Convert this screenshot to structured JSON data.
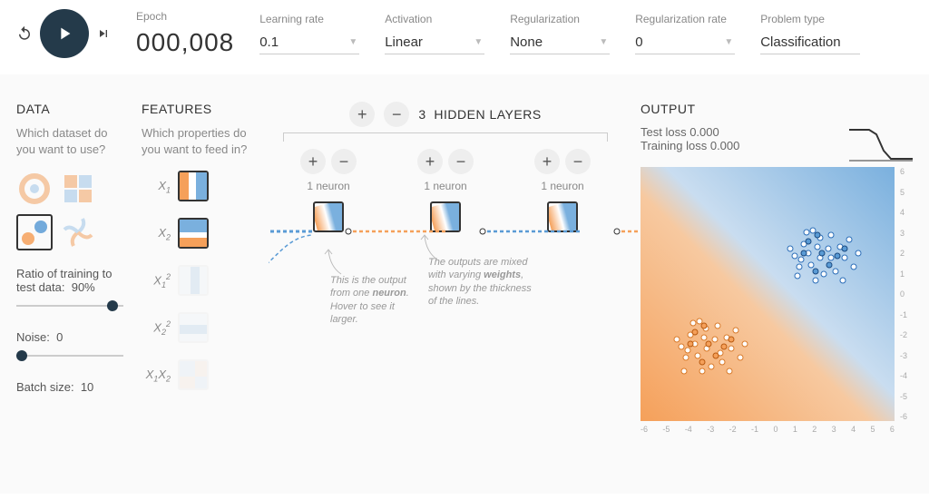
{
  "topbar": {
    "epoch_label": "Epoch",
    "epoch_value": "000,008",
    "learning_rate": {
      "label": "Learning rate",
      "value": "0.1"
    },
    "activation": {
      "label": "Activation",
      "value": "Linear"
    },
    "regularization": {
      "label": "Regularization",
      "value": "None"
    },
    "regularization_rate": {
      "label": "Regularization rate",
      "value": "0"
    },
    "problem_type": {
      "label": "Problem type",
      "value": "Classification"
    }
  },
  "data": {
    "title": "DATA",
    "desc": "Which dataset do you want to use?",
    "datasets": [
      "circle",
      "xor",
      "gauss",
      "spiral"
    ],
    "selected_dataset_index": 2,
    "ratio_label": "Ratio of training to test data:",
    "ratio_value": "90%",
    "noise_label": "Noise:",
    "noise_value": "0",
    "batch_label": "Batch size:",
    "batch_value": "10"
  },
  "features": {
    "title": "FEATURES",
    "desc": "Which properties do you want to feed in?",
    "items": [
      {
        "label_html": "X<sub>1</sub>",
        "active": true
      },
      {
        "label_html": "X<sub>2</sub>",
        "active": true
      },
      {
        "label_html": "X<sub>1</sub><sup>2</sup>",
        "active": false
      },
      {
        "label_html": "X<sub>2</sub><sup>2</sup>",
        "active": false
      },
      {
        "label_html": "X<sub>1</sub>X<sub>2</sub>",
        "active": false
      }
    ]
  },
  "network": {
    "layers_count": "3",
    "hidden_title": "HIDDEN LAYERS",
    "layers": [
      {
        "neurons": "1 neuron"
      },
      {
        "neurons": "1 neuron"
      },
      {
        "neurons": "1 neuron"
      }
    ],
    "callout_neuron": "This is the output from one ",
    "callout_neuron_bold": "neuron",
    "callout_neuron_tail": ". Hover to see it larger.",
    "callout_weights_1": "The outputs are mixed with varying ",
    "callout_weights_bold": "weights",
    "callout_weights_2": ", shown by the thickness of the lines."
  },
  "output": {
    "title": "OUTPUT",
    "test_loss_label": "Test loss",
    "test_loss_value": "0.000",
    "train_loss_label": "Training loss",
    "train_loss_value": "0.000",
    "axis_ticks": [
      "6",
      "5",
      "4",
      "3",
      "2",
      "1",
      "0",
      "-1",
      "-2",
      "-3",
      "-4",
      "-5",
      "-6"
    ]
  },
  "colors": {
    "orange": "#f5a05a",
    "blue": "#5a9bd5",
    "dark": "#243a4a"
  },
  "chart_data": {
    "type": "loss_curve",
    "x": [
      0,
      1,
      2,
      3,
      4,
      5,
      6,
      7,
      8
    ],
    "test_loss": [
      0.5,
      0.5,
      0.48,
      0.3,
      0.1,
      0.02,
      0.0,
      0.0,
      0.0
    ],
    "train_loss": [
      0.5,
      0.5,
      0.48,
      0.3,
      0.1,
      0.02,
      0.0,
      0.0,
      0.0
    ],
    "ylim": [
      0,
      0.5
    ]
  }
}
